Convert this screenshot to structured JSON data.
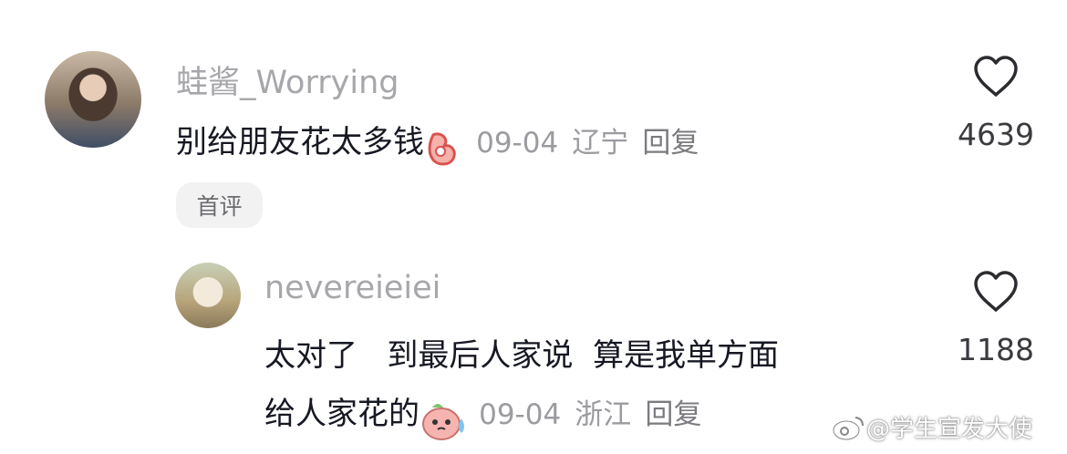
{
  "comments": [
    {
      "username": "蛙酱_Worrying",
      "text": "别给朋友花太多钱",
      "emoji": "ok-hand-emoji",
      "date": "09-04",
      "location": "辽宁",
      "reply_label": "回复",
      "likes": "4639",
      "badge": "首评"
    },
    {
      "username": "nevereieiei",
      "text_line1": "太对了   到最后人家说  算是我单方面",
      "text_line2": "给人家花的",
      "emoji": "sweat-face-emoji",
      "date": "09-04",
      "location": "浙江",
      "reply_label": "回复",
      "likes": "1188"
    }
  ],
  "watermark": "@学生宣发大使",
  "icons": {
    "like": "heart-outline-icon",
    "watermark_logo": "weibo-logo-icon"
  },
  "colors": {
    "username": "#a7a7ab",
    "text": "#161823",
    "meta": "#9b9ba0"
  }
}
